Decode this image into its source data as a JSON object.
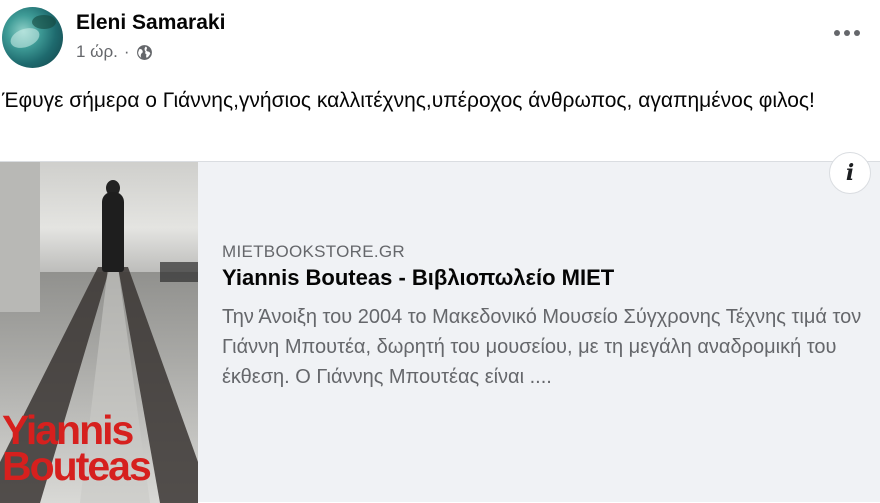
{
  "post": {
    "author": "Eleni Samaraki",
    "timestamp": "1 ώρ.",
    "separator": "·",
    "privacy_icon": "globe-icon",
    "more_icon": "more-options-icon",
    "text": "Έφυγε σήμερα ο Γιάννης,γνήσιος καλλιτέχνης,υπέροχος άνθρωπος, αγαπημένος φιλος!"
  },
  "link_card": {
    "domain": "MIETBOOKSTORE.GR",
    "title": "Yiannis Bouteas - Βιβλιοπωλείο ΜΙΕΤ",
    "description": "Την Άνοιξη του 2004 το Μακεδονικό Μουσείο Σύγχρονης Τέχνης τιμά τον Γιάννη Μπουτέα, δωρητή του μουσείου, με τη μεγάλη αναδρομική του έκθεση. Ο Γιάννης Μπουτέας είναι ....",
    "info_label": "i",
    "thumbnail_text": [
      "Yiannis",
      "Bouteas"
    ],
    "accent_color": "#d6201e"
  }
}
